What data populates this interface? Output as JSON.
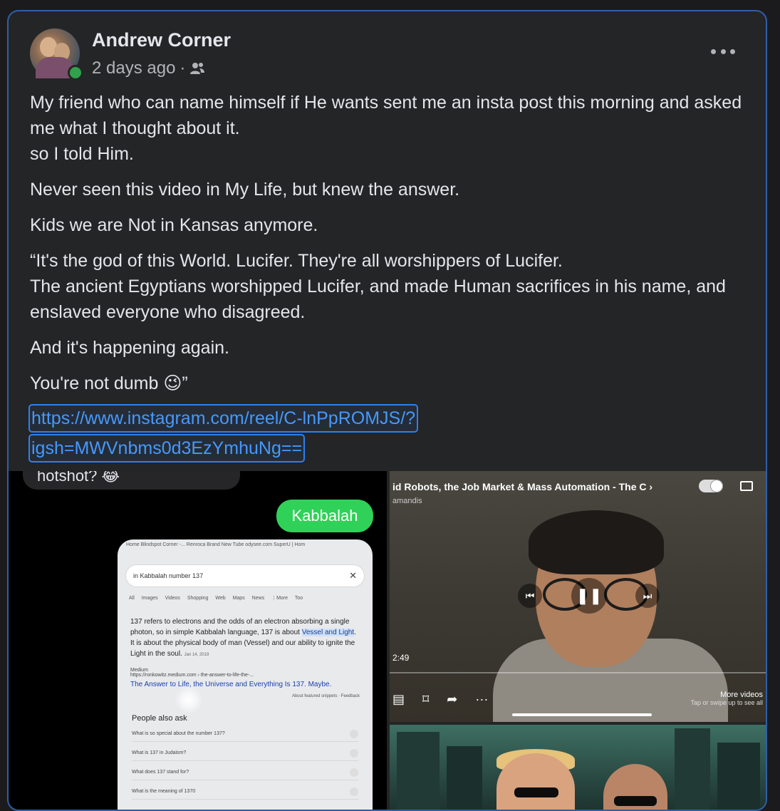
{
  "post": {
    "author": "Andrew Corner",
    "timestamp": "2 days ago",
    "audience_icon": "friends-icon",
    "paragraphs": [
      "My friend who can name himself if He wants sent me an insta post this morning and asked me what I thought about it.\nso I told Him.",
      "Never seen this video in My Life, but knew the answer.",
      "Kids we are Not in Kansas anymore.",
      "“It's the god of this World. Lucifer. They're all worshippers of Lucifer.\nThe ancient Egyptians worshipped Lucifer, and made Human sacrifices in his name, and enslaved everyone who disagreed.",
      "And it's happening again.",
      "You're not dumb 😉”"
    ],
    "link_line1": "https://www.instagram.com/reel/C-lnPpROMJS/?",
    "link_line2": "igsh=MWVnbms0d3EzYmhuNg=="
  },
  "media_left": {
    "gray_bubble": "hotshot? 😂",
    "green_bubble": "Kabbalah",
    "browser_tabs": "Home   Blindspot Corner -...   Renroca   Brand New Tube   odysee.com   SuperU | Hom",
    "search_query": "in Kabbalah number 137",
    "search_nav": "All Images Videos Shopping Web Maps News ⋮More Too",
    "answer_pre": "137 refers to electrons and the odds of an electron absorbing a single photon, so in simple Kabbalah language, 137 is about ",
    "answer_mark": "Vessel and Light",
    "answer_post": ". It is about the physical body of man (Vessel) and our ability to ignite the Light in the soul.",
    "answer_date": "Jan 14, 2019",
    "source_name": "Medium",
    "source_url": "https://ronkowitz.medium.com › the-answer-to-life-the-...",
    "result_title": "The Answer to Life, the Universe and Everything Is 137. Maybe.",
    "feedback": "About featured snippets  ·  Feedback",
    "people_also_ask": "People also ask",
    "questions": [
      "What is so special about the number 137?",
      "What is 137 in Judaism?",
      "What does 137 stand for?",
      "What is the meaning of 1370"
    ]
  },
  "media_right": {
    "video_title": "id Robots, the Job Market & Mass Automation - The C",
    "channel": "amandis",
    "time": "2:49",
    "more_videos": "More videos",
    "more_videos_hint": "Tap or swipe up to see all"
  }
}
